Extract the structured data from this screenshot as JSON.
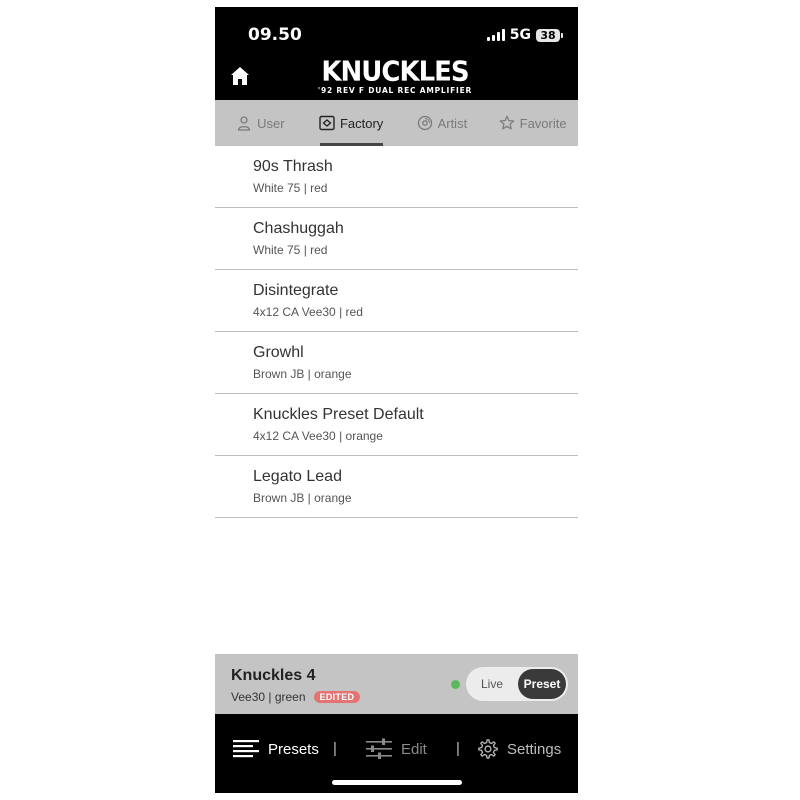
{
  "status_bar": {
    "time": "09.50",
    "network": "5G",
    "battery": "38"
  },
  "header": {
    "logo_main": "KNUCKLES",
    "logo_sub": "'92 REV F DUAL REC AMPLIFIER"
  },
  "tabs": [
    {
      "label": "User",
      "icon": "user-icon",
      "active": false
    },
    {
      "label": "Factory",
      "icon": "factory-icon",
      "active": true
    },
    {
      "label": "Artist",
      "icon": "artist-icon",
      "active": false
    },
    {
      "label": "Favorite",
      "icon": "star-icon",
      "active": false
    }
  ],
  "presets": [
    {
      "name": "90s Thrash",
      "detail": "White 75 | red"
    },
    {
      "name": "Chashuggah",
      "detail": "White 75 | red"
    },
    {
      "name": "Disintegrate",
      "detail": "4x12 CA Vee30 | red"
    },
    {
      "name": "Growhl",
      "detail": "Brown JB | orange"
    },
    {
      "name": "Knuckles Preset Default",
      "detail": "4x12 CA Vee30 | orange"
    },
    {
      "name": "Legato Lead",
      "detail": "Brown JB | orange"
    }
  ],
  "current_preset": {
    "name": "Knuckles 4",
    "detail": "Vee30 | green",
    "badge": "EDITED",
    "status_color": "#5cb85c",
    "toggle_live": "Live",
    "toggle_preset": "Preset"
  },
  "bottom_nav": {
    "presets": "Presets",
    "separator": "|",
    "edit": "Edit",
    "settings": "Settings"
  },
  "colors": {
    "accent_badge": "#e57373",
    "header_bg": "#000000",
    "tab_bg": "#c4c4c4"
  }
}
